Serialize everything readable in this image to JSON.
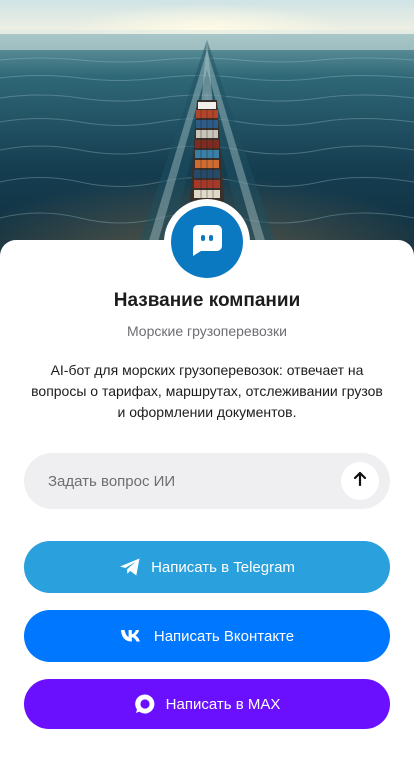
{
  "company": {
    "name": "Название компании",
    "tagline": "Морские грузоперевозки",
    "description": "AI-бот для морских грузоперевозок: отвечает на вопросы о тарифах, маршрутах, отслеживании грузов и оформлении документов."
  },
  "ask": {
    "placeholder": "Задать вопрос ИИ",
    "value": "",
    "send_icon": "arrow-up-icon"
  },
  "buttons": {
    "telegram": {
      "label": "Написать в Telegram",
      "icon": "telegram-icon"
    },
    "vk": {
      "label": "Написать Вконтакте",
      "icon": "vk-icon"
    },
    "max": {
      "label": "Написать в MAX",
      "icon": "max-icon"
    }
  },
  "avatar": {
    "icon": "chat-bot-icon"
  },
  "hero": {
    "icon": "cargo-ship-photo"
  },
  "colors": {
    "avatar": "#0a79c2",
    "telegram": "#2aa0dc",
    "vk": "#0077ff",
    "max": "#6a10ff",
    "ask_bg": "#efeff1"
  }
}
